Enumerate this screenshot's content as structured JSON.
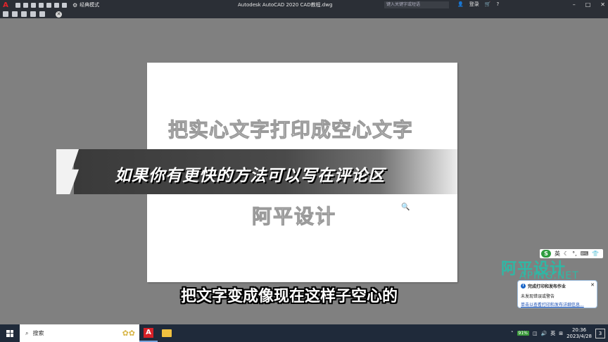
{
  "titlebar": {
    "workspace": "经典模式",
    "app_title": "Autodesk AutoCAD 2020    CAD教程.dwg",
    "search_placeholder": "键入关键字或短语",
    "login": "登录"
  },
  "drawing": {
    "line1": "把实心文字打印成空心文字",
    "line2": "阿平设计"
  },
  "overlay": {
    "banner": "如果你有更快的方法可以写在评论区",
    "subtitle": "把文字变成像现在这样子空心的"
  },
  "ime": {
    "mode": "英"
  },
  "watermark": {
    "big": "阿平设计",
    "small": "APING.NET"
  },
  "notification": {
    "title": "完成打印和发布作业",
    "line": "未发现错误或警告",
    "link": "单击以查看打印和发布详细信息..."
  },
  "taskbar": {
    "search": "搜索",
    "battery": "91%",
    "ime": "英",
    "time": "20:36",
    "date": "2023/4/28",
    "badge": "3"
  },
  "colors": {
    "autocad_red": "#d72128",
    "watermark_teal": "#2fb8a5",
    "titlebar_bg": "#2b2f36",
    "canvas_bg": "#808080"
  }
}
